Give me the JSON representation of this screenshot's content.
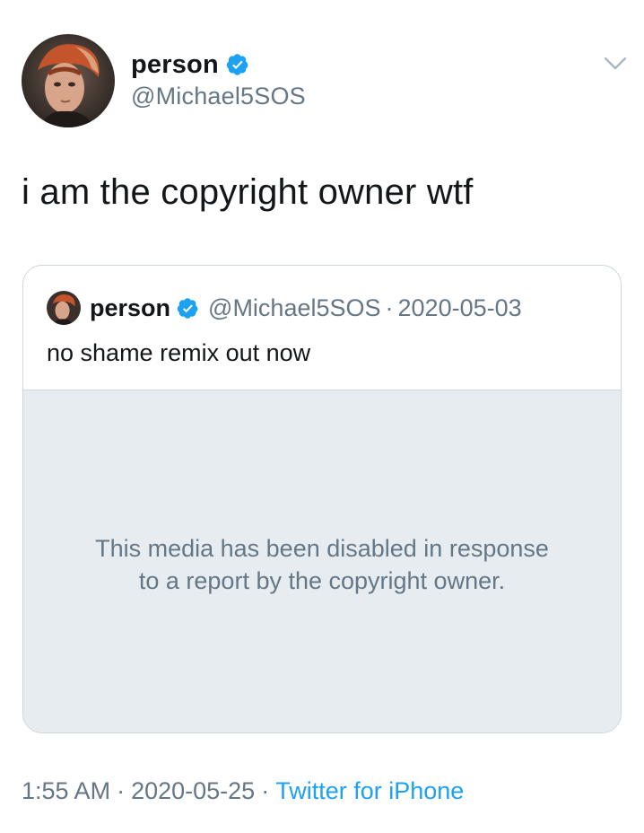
{
  "author": {
    "display_name": "person",
    "handle": "@Michael5SOS",
    "verified": true
  },
  "tweet": {
    "text": "i am the copyright owner wtf"
  },
  "quoted_tweet": {
    "display_name": "person",
    "handle": "@Michael5SOS",
    "separator": "·",
    "date": "2020-05-03",
    "text": "no shame remix out now",
    "media_notice_line1": "This media has been disabled in response",
    "media_notice_line2": "to a report by the copyright owner."
  },
  "footer": {
    "time": "1:55 AM",
    "separator": "·",
    "date": "2020-05-25",
    "source": "Twitter for iPhone"
  },
  "icons": {
    "verified": "verified-badge-icon",
    "caret": "chevron-down-icon"
  },
  "colors": {
    "accent": "#1da1f2",
    "secondary_text": "#657786",
    "primary_text": "#14171a",
    "border": "#ccd6dd",
    "media_background": "#e6ecf0"
  }
}
